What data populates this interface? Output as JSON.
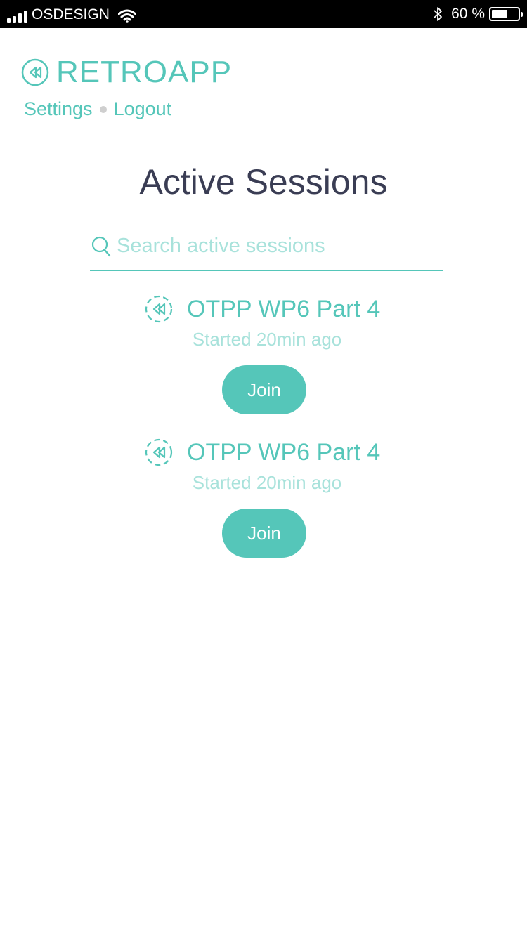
{
  "status_bar": {
    "carrier": "OSDESIGN",
    "battery_percent_label": "60 %",
    "battery_level": 0.6
  },
  "app": {
    "name": "RETROAPP",
    "accent_color": "#55c6b9"
  },
  "nav": {
    "settings_label": "Settings",
    "logout_label": "Logout"
  },
  "page": {
    "title": "Active Sessions"
  },
  "search": {
    "placeholder": "Search active sessions",
    "value": ""
  },
  "sessions": [
    {
      "name": "OTPP WP6 Part 4",
      "started": "Started 20min ago",
      "join_label": "Join"
    },
    {
      "name": "OTPP WP6 Part 4",
      "started": "Started 20min ago",
      "join_label": "Join"
    }
  ],
  "icons": {
    "brand": "rewind-circle-icon",
    "session": "rewind-dashed-circle-icon",
    "search": "search-icon"
  }
}
